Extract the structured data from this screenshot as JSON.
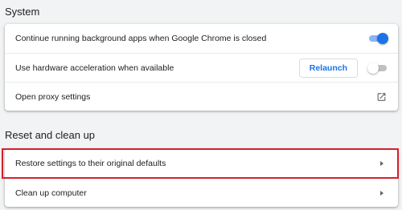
{
  "system": {
    "title": "System",
    "rows": [
      {
        "label": "Continue running background apps when Google Chrome is closed",
        "toggle": "on"
      },
      {
        "label": "Use hardware acceleration when available",
        "button": "Relaunch",
        "toggle": "off"
      },
      {
        "label": "Open proxy settings",
        "icon": "external-link-icon"
      }
    ]
  },
  "reset": {
    "title": "Reset and clean up",
    "rows": [
      {
        "label": "Restore settings to their original defaults",
        "icon": "arrow-right-icon"
      },
      {
        "label": "Clean up computer",
        "icon": "arrow-right-icon"
      }
    ]
  },
  "highlight": {
    "target": "Restore settings to their original defaults",
    "color": "#d6202a"
  },
  "colors": {
    "accent": "#1a73e8",
    "background": "#f1f3f4"
  }
}
